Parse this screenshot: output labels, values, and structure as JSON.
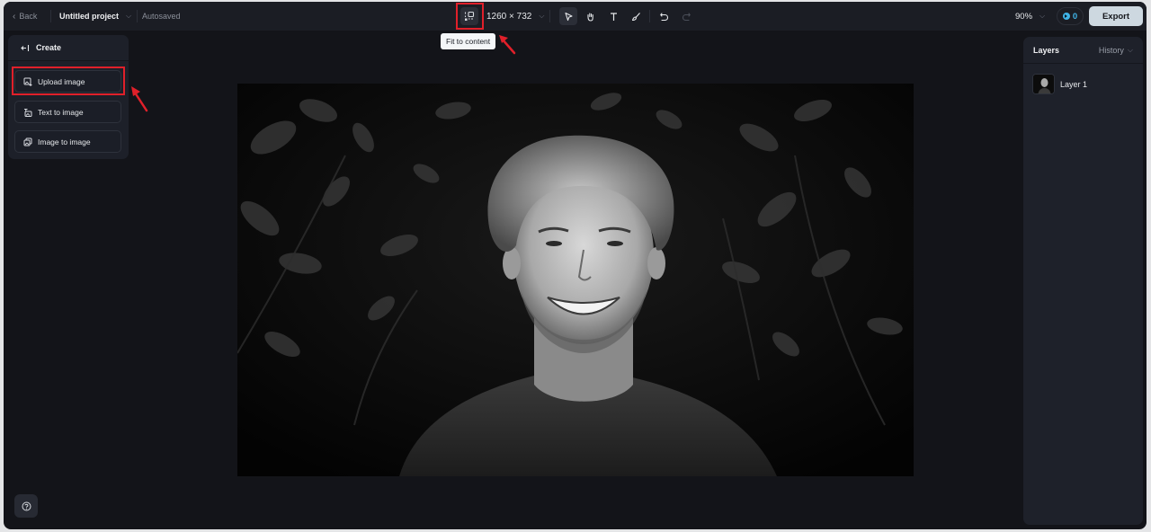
{
  "topbar": {
    "back_label": "Back",
    "project_name": "Untitled project",
    "save_status": "Autosaved",
    "canvas_size": "1260 × 732",
    "zoom_level": "90%",
    "credits": "0",
    "export_label": "Export"
  },
  "tooltip": {
    "fit_to_content": "Fit to content"
  },
  "tools": [
    {
      "name": "select",
      "icon": "cursor-icon",
      "active": true
    },
    {
      "name": "hand",
      "icon": "hand-icon",
      "active": false
    },
    {
      "name": "text",
      "icon": "text-icon",
      "active": false
    },
    {
      "name": "brush",
      "icon": "brush-icon",
      "active": false
    },
    {
      "name": "undo",
      "icon": "undo-icon",
      "active": false
    },
    {
      "name": "redo",
      "icon": "redo-icon",
      "active": false
    }
  ],
  "left_panel": {
    "header": "Create",
    "items": [
      {
        "label": "Upload image",
        "icon": "upload-image-icon",
        "highlighted": true
      },
      {
        "label": "Text to image",
        "icon": "text-to-image-icon",
        "highlighted": false
      },
      {
        "label": "Image to image",
        "icon": "image-to-image-icon",
        "highlighted": false
      }
    ]
  },
  "right_panel": {
    "title": "Layers",
    "history_label": "History",
    "layers": [
      {
        "label": "Layer 1"
      }
    ]
  },
  "canvas": {
    "image_description": "Black and white portrait of a smiling young man with curly hair against dark foliage"
  },
  "colors": {
    "accent": "#3fb4e8",
    "annotation_red": "#e0202a",
    "export_bg": "#cdd8e0"
  }
}
